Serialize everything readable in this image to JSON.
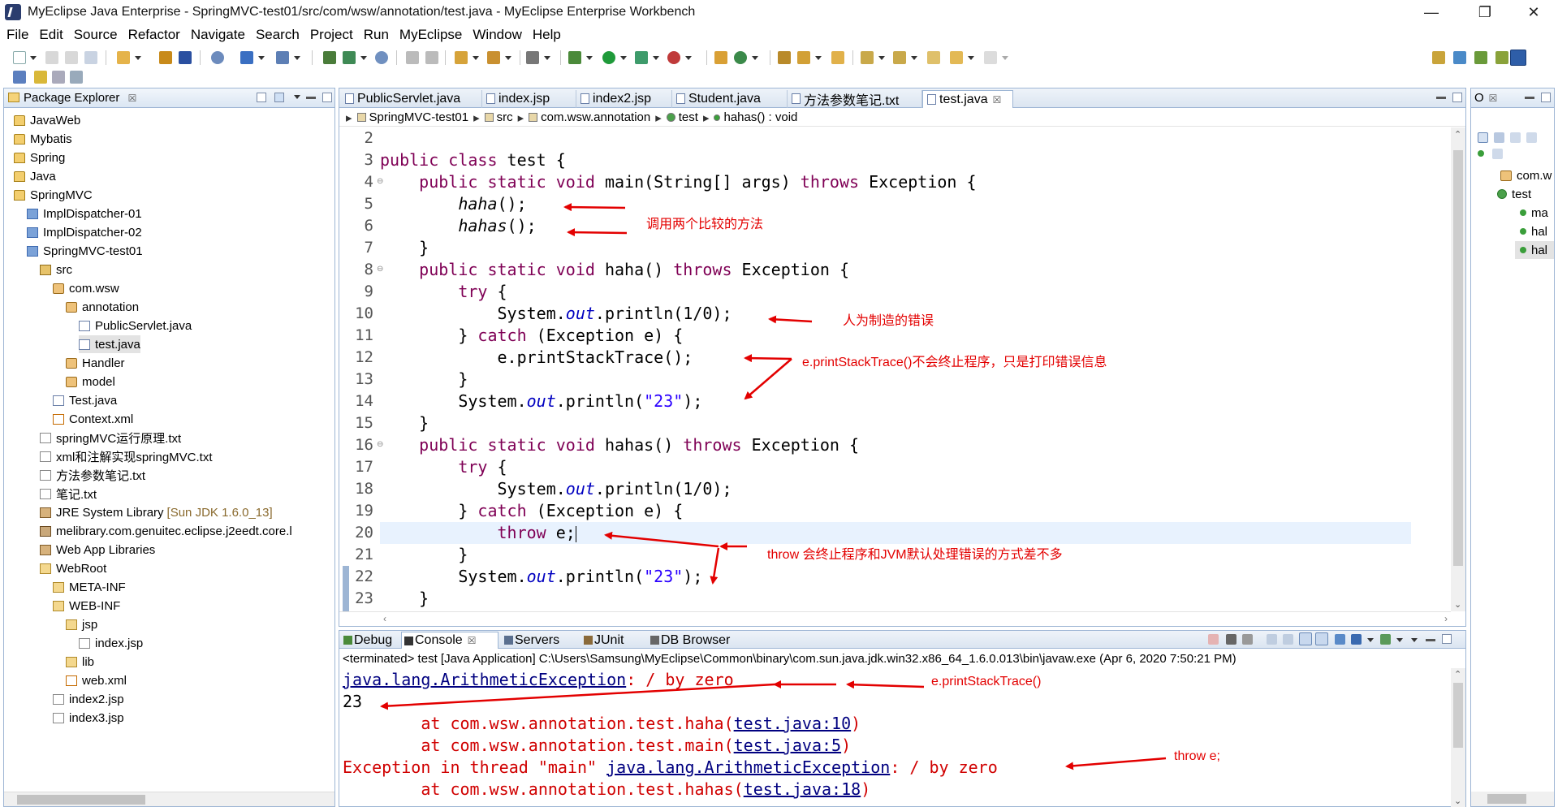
{
  "window": {
    "title": "MyEclipse Java Enterprise - SpringMVC-test01/src/com/wsw/annotation/test.java - MyEclipse Enterprise Workbench",
    "minimize": "—",
    "maximize": "❐",
    "close": "✕"
  },
  "menu": [
    "File",
    "Edit",
    "Source",
    "Refactor",
    "Navigate",
    "Search",
    "Project",
    "Run",
    "MyEclipse",
    "Window",
    "Help"
  ],
  "package_explorer": {
    "title": "Package Explorer",
    "close": "☒",
    "items": [
      {
        "label": "JavaWeb",
        "icon": "project-icon",
        "decor": ""
      },
      {
        "label": "Mybatis",
        "icon": "project-icon",
        "decor": ""
      },
      {
        "label": "Spring",
        "icon": "project-icon",
        "decor": ""
      },
      {
        "label": "Java",
        "icon": "project-icon",
        "decor": ""
      },
      {
        "label": "SpringMVC",
        "icon": "project-icon",
        "decor": ""
      },
      {
        "label": "ImplDispatcher-01",
        "icon": "web-project-icon",
        "decor": ""
      },
      {
        "label": "ImplDispatcher-02",
        "icon": "web-project-icon",
        "decor": ""
      },
      {
        "label": "SpringMVC-test01",
        "icon": "web-project-icon",
        "decor": ""
      },
      {
        "label": "src",
        "icon": "source-folder-icon",
        "decor": ""
      },
      {
        "label": "com.wsw",
        "icon": "package-icon",
        "decor": ""
      },
      {
        "label": "annotation",
        "icon": "package-icon",
        "decor": ""
      },
      {
        "label": "PublicServlet.java",
        "icon": "java-file-icon",
        "decor": ""
      },
      {
        "label": "test.java",
        "icon": "java-file-icon",
        "decor": ""
      },
      {
        "label": "Handler",
        "icon": "package-icon",
        "decor": ""
      },
      {
        "label": "model",
        "icon": "package-icon",
        "decor": ""
      },
      {
        "label": "Test.java",
        "icon": "java-file-icon",
        "decor": ""
      },
      {
        "label": "Context.xml",
        "icon": "xml-file-icon",
        "decor": ""
      },
      {
        "label": "springMVC运行原理.txt",
        "icon": "text-file-icon",
        "decor": ""
      },
      {
        "label": "xml和注解实现springMVC.txt",
        "icon": "text-file-icon",
        "decor": ""
      },
      {
        "label": "方法参数笔记.txt",
        "icon": "text-file-icon",
        "decor": ""
      },
      {
        "label": "笔记.txt",
        "icon": "text-file-icon",
        "decor": ""
      },
      {
        "label": "JRE System Library",
        "icon": "library-icon",
        "decor": "[Sun JDK 1.6.0_13]"
      },
      {
        "label": "melibrary.com.genuitec.eclipse.j2eedt.core.l",
        "icon": "jar-icon",
        "decor": ""
      },
      {
        "label": "Web App Libraries",
        "icon": "library-icon",
        "decor": ""
      },
      {
        "label": "WebRoot",
        "icon": "folder-icon",
        "decor": ""
      },
      {
        "label": "META-INF",
        "icon": "folder-icon",
        "decor": ""
      },
      {
        "label": "WEB-INF",
        "icon": "folder-icon",
        "decor": ""
      },
      {
        "label": "jsp",
        "icon": "folder-icon",
        "decor": ""
      },
      {
        "label": "index.jsp",
        "icon": "text-file-icon",
        "decor": ""
      },
      {
        "label": "lib",
        "icon": "folder-icon",
        "decor": ""
      },
      {
        "label": "web.xml",
        "icon": "xml-file-icon",
        "decor": ""
      },
      {
        "label": "index2.jsp",
        "icon": "text-file-icon",
        "decor": ""
      },
      {
        "label": "index3.jsp",
        "icon": "text-file-icon",
        "decor": ""
      }
    ]
  },
  "editor": {
    "tabs": [
      "PublicServlet.java",
      "index.jsp",
      "index2.jsp",
      "Student.java",
      "方法参数笔记.txt",
      "test.java"
    ],
    "active_tab_close": "☒",
    "breadcrumb": [
      "SpringMVC-test01",
      "src",
      "com.wsw.annotation",
      "test",
      "hahas() : void"
    ],
    "line_numbers": [
      "2",
      "3",
      "4",
      "5",
      "6",
      "7",
      "8",
      "9",
      "10",
      "11",
      "12",
      "13",
      "14",
      "15",
      "16",
      "17",
      "18",
      "19",
      "20",
      "21",
      "22",
      "23"
    ],
    "code": {
      "l3_kw": "public class",
      "l3_rest": " test {",
      "l4_kw": "public static void",
      "l4_mid": " main(String[] args) ",
      "l4_kw2": "throws",
      "l4_rest": " Exception {",
      "l5": "haha",
      "l5_rest": "();",
      "l6": "hahas",
      "l6_rest": "();",
      "close_brace": "}",
      "l8_kw": "public static void",
      "l8_mid": " haha() ",
      "l8_kw2": "throws",
      "l8_rest": " Exception {",
      "try_kw": "try",
      "try_rest": " {",
      "sys": "System.",
      "out": "out",
      "println_div": ".println(1/0);",
      "catch_open": "} ",
      "catch_kw": "catch",
      "catch_rest": " (Exception e) {",
      "l12": "e.printStackTrace();",
      "println_open": ".println(",
      "str23": "\"23\"",
      "println_close": ");",
      "l16_kw": "public static void",
      "l16_mid": " hahas() ",
      "l16_kw2": "throws",
      "l16_rest": " Exception {",
      "throw_kw": "throw",
      "throw_rest": " e;"
    }
  },
  "outline": {
    "title": "O",
    "items": [
      "com.w",
      "test",
      "ma",
      "hal",
      "hal"
    ]
  },
  "console": {
    "tabs": [
      "Debug",
      "Console",
      "Servers",
      "JUnit",
      "DB Browser"
    ],
    "status": "<terminated> test [Java Application] C:\\Users\\Samsung\\MyEclipse\\Common\\binary\\com.sun.java.jdk.win32.x86_64_1.6.0.013\\bin\\javaw.exe (Apr 6, 2020 7:50:21 PM)",
    "exc_link": "java.lang.ArithmeticException",
    "exc_msg": ": / by zero",
    "out23": "23",
    "at1_pre": "        at com.wsw.annotation.test.haha(",
    "at1_link": "test.java:10",
    "at2_pre": "        at com.wsw.annotation.test.main(",
    "at2_link": "test.java:5",
    "at_close": ")",
    "thread_pre": "Exception in thread \"main\" ",
    "at3_pre": "        at com.wsw.annotation.test.hahas(",
    "at3_link": "test.java:18"
  },
  "annotations": {
    "call_two": "调用两个比较的方法",
    "manual_error": "人为制造的错误",
    "print_stack": "e.printStackTrace()不会终止程序，只是打印错误信息",
    "throw_note": "throw 会终止程序和JVM默认处理错误的方式差不多",
    "console_pst": "e.printStackTrace()",
    "console_throw": "throw e;"
  },
  "colors": {
    "keyword": "#7f0055",
    "field": "#0000c0",
    "string": "#2a00ff",
    "annotation": "#e30000",
    "panel_border": "#9db5d4"
  }
}
